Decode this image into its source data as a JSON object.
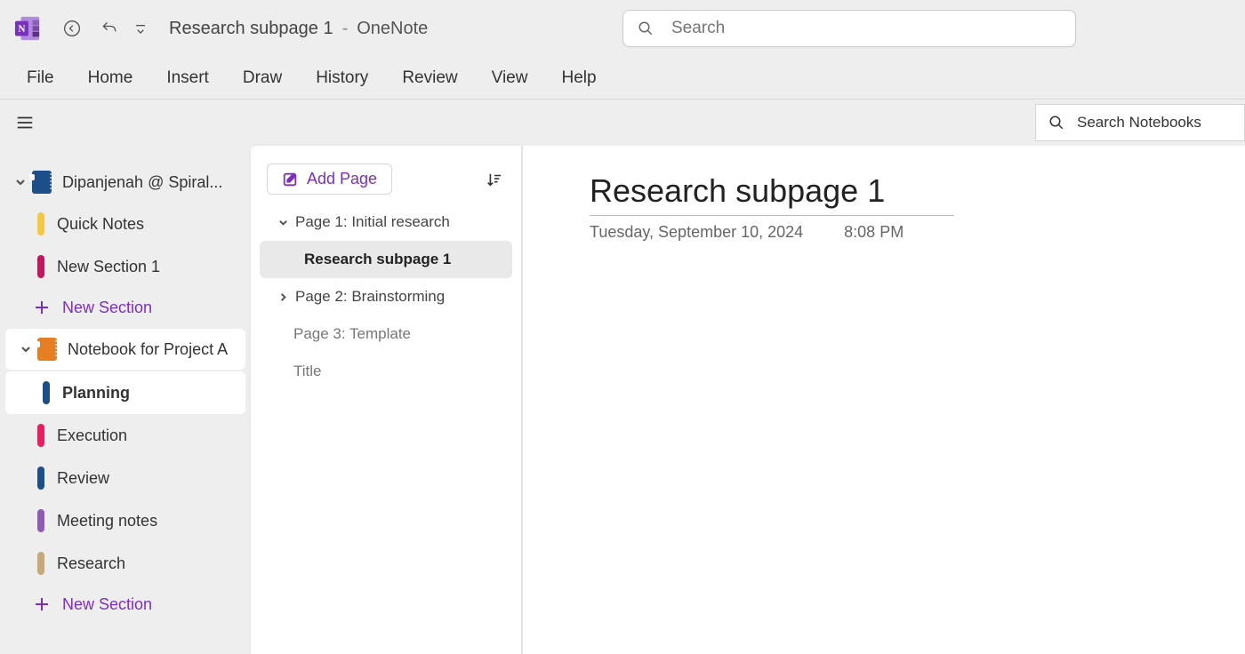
{
  "titlebar": {
    "page_name": "Research subpage 1",
    "separator": "-",
    "app_name": "OneNote"
  },
  "search": {
    "placeholder": "Search"
  },
  "ribbon": [
    "File",
    "Home",
    "Insert",
    "Draw",
    "History",
    "Review",
    "View",
    "Help"
  ],
  "search_notebooks": {
    "placeholder": "Search Notebooks"
  },
  "sidebar": {
    "notebooks": [
      {
        "name": "Dipanjenah @ Spiral...",
        "icon_color": "blue",
        "expanded": true,
        "sections": [
          {
            "name": "Quick Notes",
            "swatch": "yellow"
          },
          {
            "name": "New Section 1",
            "swatch": "magenta"
          }
        ],
        "new_section_label": "New Section"
      },
      {
        "name": "Notebook for Project A",
        "icon_color": "orange",
        "expanded": true,
        "boxed": true,
        "sections": [
          {
            "name": "Planning",
            "swatch": "blue",
            "selected": true
          },
          {
            "name": "Execution",
            "swatch": "pink"
          },
          {
            "name": "Review",
            "swatch": "blue"
          },
          {
            "name": "Meeting notes",
            "swatch": "purple"
          },
          {
            "name": "Research",
            "swatch": "tan"
          }
        ],
        "new_section_label": "New Section"
      }
    ]
  },
  "pagepane": {
    "add_page_label": "Add Page",
    "items": [
      {
        "label": "Page 1: Initial research",
        "chevron": "down"
      },
      {
        "label": "Research subpage 1",
        "sub": true,
        "selected": true
      },
      {
        "label": "Page 2: Brainstorming",
        "chevron": "right"
      },
      {
        "label": "Page 3: Template",
        "muted": true
      },
      {
        "label": "Title",
        "muted": true
      }
    ]
  },
  "content": {
    "title": "Research subpage 1",
    "date": "Tuesday, September 10, 2024",
    "time": "8:08 PM"
  }
}
